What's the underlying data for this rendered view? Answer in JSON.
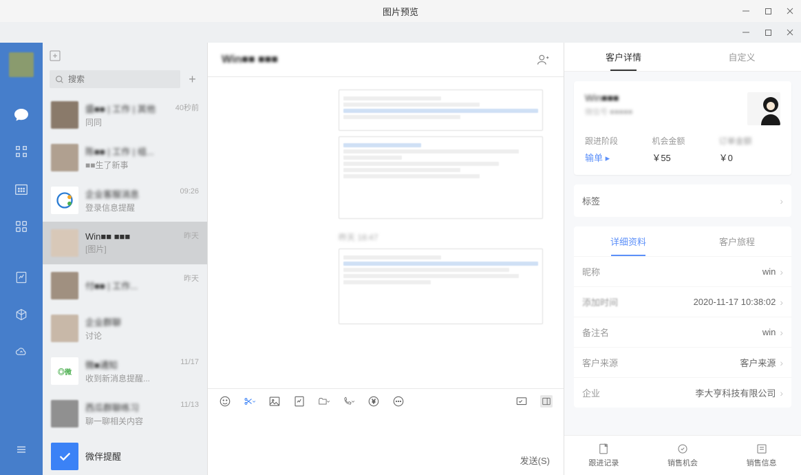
{
  "titlebar": {
    "title": "图片预览"
  },
  "search": {
    "placeholder": "搜索"
  },
  "chats": [
    {
      "name": "盛■■ | 工作 | 其他",
      "preview": "同同",
      "time": "40秒前"
    },
    {
      "name": "陈■■ | 工作 | 组...",
      "preview": "■■生了新事",
      "time": ""
    },
    {
      "name": "企业客服消息",
      "preview": "登录信息提醒",
      "time": "09:26"
    },
    {
      "name": "Win■■ ■■■",
      "preview": "[图片]",
      "time": "昨天"
    },
    {
      "name": "付■■ | 工作...",
      "preview": "",
      "time": "昨天"
    },
    {
      "name": "企业群聊",
      "preview": "讨论",
      "time": ""
    },
    {
      "name": "微■通知",
      "preview": "收到新消息提醒...",
      "time": "11/17"
    },
    {
      "name": "西瓜群聊练习",
      "preview": "聊一聊相关内容",
      "time": "11/13"
    },
    {
      "name": "微伴提醒",
      "preview": "",
      "time": ""
    }
  ],
  "main": {
    "title": "Win■■ ■■■",
    "msg_text": "昨天 18:47",
    "send_label": "发送(S)"
  },
  "panel": {
    "tab1": "客户详情",
    "tab2": "自定义",
    "cust_name": "Win■■■",
    "cust_sub": "微信号 ■■■■■",
    "stat1_label": "跟进阶段",
    "stat1_val": "输单 ▸",
    "stat2_label": "机会金额",
    "stat2_val": "￥55",
    "stat3_label": "订单金额",
    "stat3_val": "￥0",
    "labels_title": "标签",
    "subtab1": "详细资料",
    "subtab2": "客户旅程",
    "details": [
      {
        "label": "昵称",
        "val": "win"
      },
      {
        "label": "添加时间",
        "val": "2020-11-17 10:38:02"
      },
      {
        "label": "备注名",
        "val": "win"
      },
      {
        "label": "客户来源",
        "val": "客户来源"
      },
      {
        "label": "企业",
        "val": "李大亨科技有限公司"
      }
    ],
    "bottom": [
      {
        "label": "跟进记录"
      },
      {
        "label": "销售机会"
      },
      {
        "label": "销售信息"
      }
    ]
  }
}
